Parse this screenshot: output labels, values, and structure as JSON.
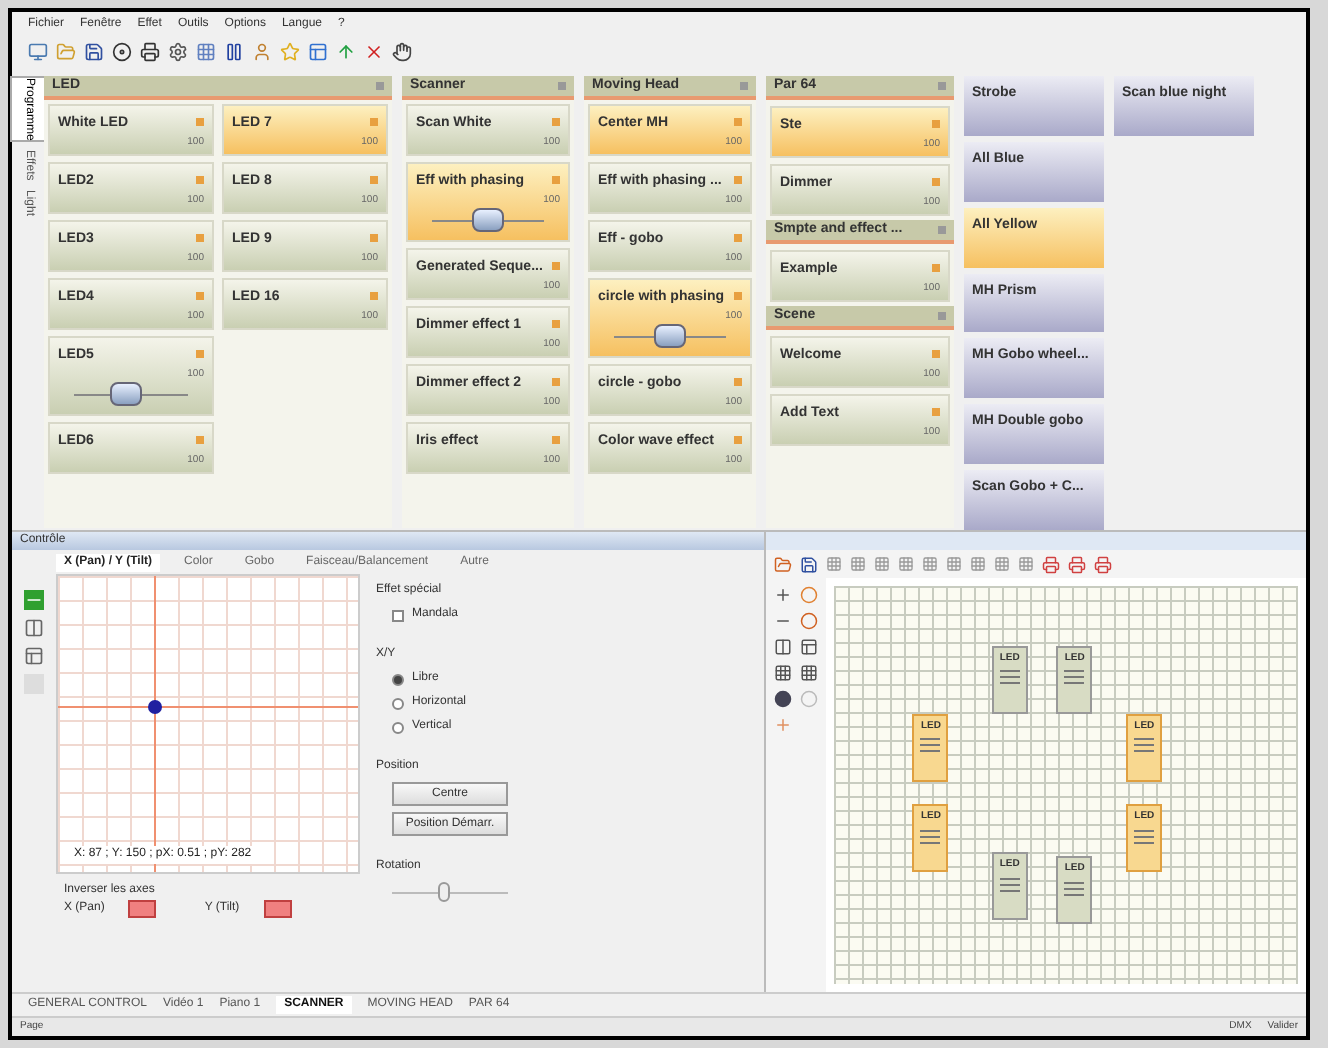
{
  "menu": [
    "Fichier",
    "Fenêtre",
    "Effet",
    "Outils",
    "Options",
    "Langue",
    "?"
  ],
  "side_tabs": [
    {
      "label": "Programme",
      "selected": true
    },
    {
      "label": "Effets",
      "selected": false
    },
    {
      "label": "Light",
      "selected": false
    }
  ],
  "groups": [
    {
      "title": "LED",
      "columns": [
        [
          {
            "name": "White LED",
            "value": "100",
            "kind": "plain",
            "selected": false
          },
          {
            "name": "LED2",
            "value": "100",
            "kind": "plain",
            "selected": false
          },
          {
            "name": "LED3",
            "value": "100",
            "kind": "plain",
            "selected": false
          },
          {
            "name": "LED4",
            "value": "100",
            "kind": "plain",
            "selected": false
          },
          {
            "name": "LED5",
            "value": "100",
            "kind": "slider",
            "selected": false,
            "level": 0.45
          },
          {
            "name": "LED6",
            "value": "100",
            "kind": "plain",
            "selected": false
          }
        ],
        [
          {
            "name": "LED 7",
            "value": "100",
            "kind": "plain",
            "selected": true
          },
          {
            "name": "LED 8",
            "value": "100",
            "kind": "plain",
            "selected": false
          },
          {
            "name": "LED 9",
            "value": "100",
            "kind": "plain",
            "selected": false
          },
          {
            "name": "LED 16",
            "value": "100",
            "kind": "plain",
            "selected": false
          }
        ]
      ]
    },
    {
      "title": "Scanner",
      "columns": [
        [
          {
            "name": "Scan White",
            "value": "100",
            "kind": "plain",
            "selected": false
          },
          {
            "name": "Eff with phasing",
            "value": "100",
            "kind": "slider",
            "selected": true,
            "level": 0.5
          },
          {
            "name": "Generated Seque...",
            "value": "100",
            "kind": "plain",
            "selected": false
          },
          {
            "name": "Dimmer effect 1",
            "value": "100",
            "kind": "plain",
            "selected": false
          },
          {
            "name": "Dimmer effect 2",
            "value": "100",
            "kind": "plain",
            "selected": false
          },
          {
            "name": "Iris effect",
            "value": "100",
            "kind": "plain",
            "selected": false
          }
        ]
      ]
    },
    {
      "title": "Moving Head",
      "columns": [
        [
          {
            "name": "Center MH",
            "value": "100",
            "kind": "plain",
            "selected": true
          },
          {
            "name": "Eff with phasing ...",
            "value": "100",
            "kind": "plain",
            "selected": false
          },
          {
            "name": "Eff - gobo",
            "value": "100",
            "kind": "plain",
            "selected": false
          },
          {
            "name": "circle with phasing",
            "value": "100",
            "kind": "slider",
            "selected": true,
            "level": 0.5
          },
          {
            "name": "circle - gobo",
            "value": "100",
            "kind": "plain",
            "selected": false
          },
          {
            "name": "Color wave effect",
            "value": "100",
            "kind": "plain",
            "selected": false
          }
        ]
      ]
    }
  ],
  "par_groups": [
    {
      "title": "Par 64",
      "items": [
        {
          "name": "Ste",
          "value": "100",
          "kind": "plain",
          "selected": true
        },
        {
          "name": "Dimmer",
          "value": "100",
          "kind": "plain",
          "selected": false
        }
      ]
    },
    {
      "title": "Smpte and effect ...",
      "items": [
        {
          "name": "Example",
          "value": "100",
          "kind": "plain",
          "selected": false
        }
      ]
    },
    {
      "title": "Scene",
      "items": [
        {
          "name": "Welcome",
          "value": "100",
          "kind": "plain",
          "selected": false
        },
        {
          "name": "Add Text",
          "value": "100",
          "kind": "plain",
          "selected": false
        }
      ]
    }
  ],
  "presets": [
    [
      {
        "name": "Strobe",
        "selected": false
      },
      {
        "name": "All Blue",
        "selected": false
      },
      {
        "name": "All Yellow",
        "selected": true
      },
      {
        "name": "MH Prism",
        "selected": false
      },
      {
        "name": "MH Gobo wheel...",
        "selected": false
      },
      {
        "name": "MH Double gobo",
        "selected": false
      },
      {
        "name": "Scan Gobo + C...",
        "selected": false
      }
    ],
    [
      {
        "name": "Scan blue night",
        "selected": false
      }
    ]
  ],
  "control": {
    "title": "Contrôle",
    "tabs": [
      {
        "label": "X (Pan) / Y (Tilt)",
        "selected": true
      },
      {
        "label": "Color",
        "selected": false
      },
      {
        "label": "Gobo",
        "selected": false
      },
      {
        "label": "Faisceau/Balancement",
        "selected": false
      },
      {
        "label": "Autre",
        "selected": false
      }
    ],
    "readout": "X: 87 ; Y: 150 ; pX: 0.51 ; pY: 282",
    "effect_label": "Effet spécial",
    "effect_checkbox": {
      "label": "Mandala",
      "checked": false
    },
    "xy_label": "X/Y",
    "xy_options": [
      {
        "label": "Libre",
        "selected": true
      },
      {
        "label": "Horizontal",
        "selected": false
      },
      {
        "label": "Vertical",
        "selected": false
      }
    ],
    "position_label": "Position",
    "position_buttons": [
      "Centre",
      "Position Démarr."
    ],
    "rotation_label": "Rotation",
    "rotation": {
      "level": 0.45
    },
    "invert_label": "Inverser les axes",
    "invert": [
      {
        "label": "X (Pan)",
        "on": true
      },
      {
        "label": "Y (Tilt)",
        "on": true
      }
    ]
  },
  "bottom_tabs": [
    {
      "label": "GENERAL CONTROL",
      "selected": false
    },
    {
      "label": "Vidéo 1",
      "selected": false
    },
    {
      "label": "Piano 1",
      "selected": false
    },
    {
      "label": "SCANNER",
      "selected": true
    },
    {
      "label": "MOVING HEAD",
      "selected": false
    },
    {
      "label": "PAR 64",
      "selected": false
    }
  ],
  "fixtures": [
    {
      "label": "LED",
      "selected": false
    },
    {
      "label": "LED",
      "selected": false
    },
    {
      "label": "LED",
      "selected": true
    },
    {
      "label": "LED",
      "selected": true
    },
    {
      "label": "LED",
      "selected": true
    },
    {
      "label": "LED",
      "selected": true
    },
    {
      "label": "LED",
      "selected": false
    },
    {
      "label": "LED",
      "selected": false
    }
  ],
  "status": {
    "left": "Page",
    "right": [
      "DMX",
      "Valider"
    ]
  }
}
